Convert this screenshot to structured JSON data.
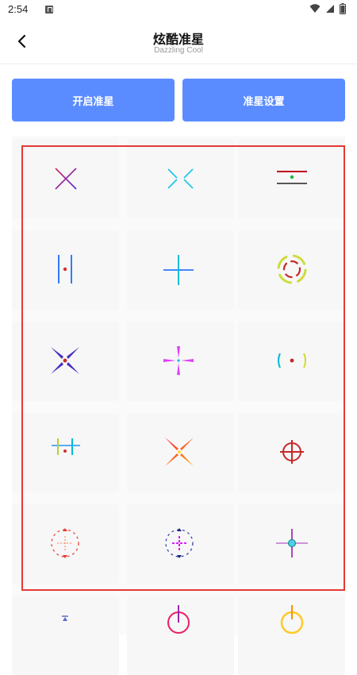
{
  "status_bar": {
    "time": "2:54",
    "icons": [
      "notification-app-icon",
      "wifi-icon",
      "signal-icon",
      "battery-icon"
    ]
  },
  "header": {
    "title": "炫酷准星",
    "subtitle": "Dazzling Cool",
    "back_icon": "back-arrow-icon"
  },
  "actions": {
    "enable_label": "开启准星",
    "settings_label": "准星设置"
  },
  "colors": {
    "button": "#5b8cff",
    "highlight_border": "#e53935",
    "cell_bg": "#f7f7f7"
  },
  "crosshairs": [
    "x-crosshair-icon",
    "split-x-crosshair-icon",
    "bracket-line-crosshair-icon",
    "vertical-bars-dot-crosshair-icon",
    "plus-crosshair-icon",
    "dashed-circle-crosshair-icon",
    "diamond-x-dot-crosshair-icon",
    "pink-plus-crosshair-icon",
    "bracket-dot-crosshair-icon",
    "hash-crosshair-icon",
    "gradient-x-dot-crosshair-icon",
    "scope-circle-crosshair-icon",
    "red-dashed-circle-crosshair-icon",
    "purple-dashed-circle-crosshair-icon",
    "plus-circle-crosshair-icon",
    "small-arrow-crosshair-icon",
    "pink-circle-crosshair-icon",
    "yellow-circle-crosshair-icon"
  ]
}
